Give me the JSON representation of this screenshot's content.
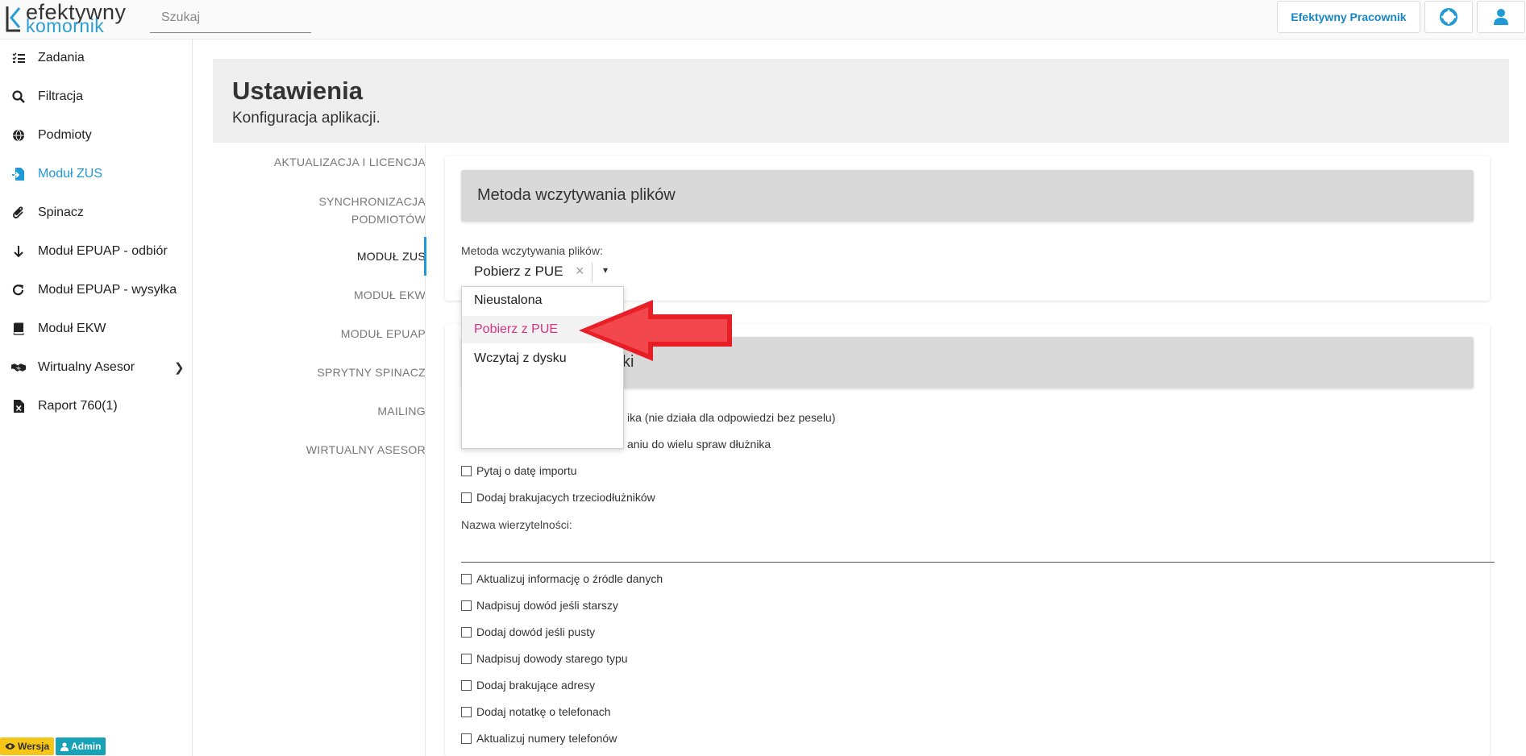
{
  "app": {
    "logo_line1": "efektywny",
    "logo_line2": "komornik",
    "search_placeholder": "Szukaj",
    "user_button_label": "Efektywny Pracownik"
  },
  "sidebar": {
    "items": [
      {
        "label": "Zadania",
        "icon": "tasks-list-icon"
      },
      {
        "label": "Filtracja",
        "icon": "search-icon"
      },
      {
        "label": "Podmioty",
        "icon": "globe-icon"
      },
      {
        "label": "Moduł ZUS",
        "icon": "file-import-icon",
        "active": true
      },
      {
        "label": "Spinacz",
        "icon": "paperclip-icon"
      },
      {
        "label": "Moduł EPUAP - odbiór",
        "icon": "arrow-down-icon"
      },
      {
        "label": "Moduł EPUAP - wysyłka",
        "icon": "redo-icon"
      },
      {
        "label": "Moduł EKW",
        "icon": "book-icon"
      },
      {
        "label": "Wirtualny Asesor",
        "icon": "handshake-icon",
        "has_submenu": true
      },
      {
        "label": "Raport 760(1)",
        "icon": "excel-file-icon"
      }
    ],
    "badges": {
      "version": "Wersja",
      "role": "Admin"
    }
  },
  "page": {
    "title": "Ustawienia",
    "subtitle": "Konfiguracja aplikacji."
  },
  "tabs": [
    {
      "label": "AKTUALIZACJA I LICENCJA"
    },
    {
      "label_line1": "SYNCHRONIZACJA",
      "label_line2": "PODMIOTÓW"
    },
    {
      "label": "MODUŁ ZUS",
      "active": true
    },
    {
      "label": "MODUŁ EKW"
    },
    {
      "label": "MODUŁ EPUAP"
    },
    {
      "label": "SPRYTNY SPINACZ"
    },
    {
      "label": "MAILING"
    },
    {
      "label": "WIRTUALNY ASESOR"
    }
  ],
  "method_card": {
    "header": "Metoda wczytywania plików",
    "field_label": "Metoda wczytywania plików:",
    "selected_value": "Pobierz z PUE",
    "clear_symbol": "×",
    "caret_symbol": "▾",
    "options": [
      "Nieustalona",
      "Pobierz z PUE",
      "Wczytaj z dysku"
    ]
  },
  "options_card": {
    "header_visible_fragment": "ki",
    "checkboxes_top": [
      {
        "label_visible": "ika (nie działa dla odpowiedzi bez peselu)",
        "checked": false
      },
      {
        "label_visible": "aniu do wielu spraw dłużnika",
        "checked": true
      },
      {
        "label": "Pytaj o datę importu",
        "checked": false
      },
      {
        "label": "Dodaj brakujacych trzeciodłużników",
        "checked": false
      }
    ],
    "text_field_label": "Nazwa wierzytelności:",
    "text_field_value": "",
    "checkboxes_bottom": [
      {
        "label": "Aktualizuj informację o źródle danych",
        "checked": false
      },
      {
        "label": "Nadpisuj dowód jeśli starszy",
        "checked": false
      },
      {
        "label": "Dodaj dowód jeśli pusty",
        "checked": false
      },
      {
        "label": "Nadpisuj dowody starego typu",
        "checked": false
      },
      {
        "label": "Dodaj brakujące adresy",
        "checked": false
      },
      {
        "label": "Dodaj notatkę o telefonach",
        "checked": false
      },
      {
        "label": "Aktualizuj numery telefonów",
        "checked": false
      }
    ]
  },
  "colors": {
    "accent": "#1f9ad6",
    "selected_option": "#d63384",
    "annotation_arrow": "#e8131b"
  }
}
